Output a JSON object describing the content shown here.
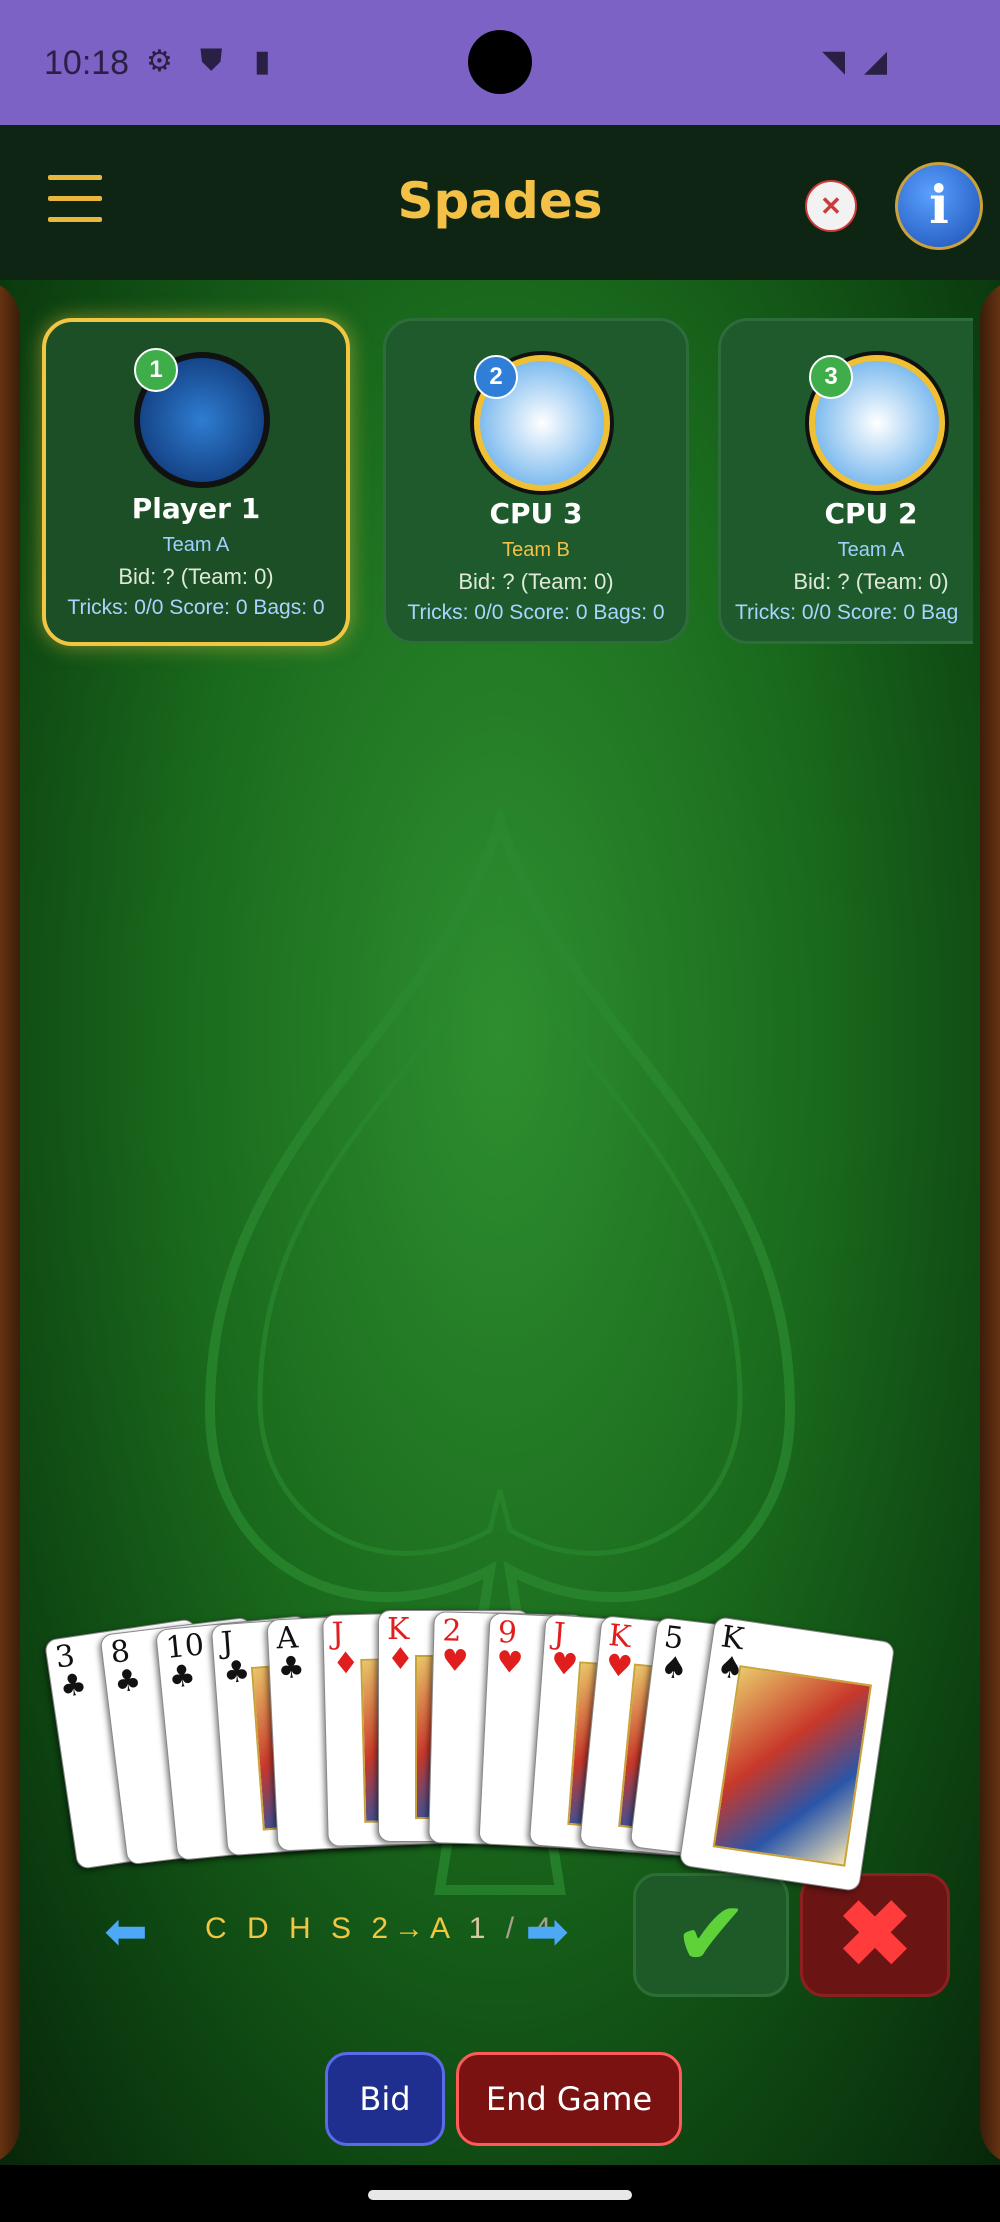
{
  "status_bar": {
    "time": "10:18"
  },
  "app_bar": {
    "title": "Spades"
  },
  "players": [
    {
      "number": "1",
      "name": "Player 1",
      "team": "Team A",
      "bid": "Bid: ?  (Team: 0)",
      "stats": "Tricks: 0/0  Score: 0  Bags: 0",
      "team_color": "#9fd0ff",
      "badge_color": "#3fae4a"
    },
    {
      "number": "2",
      "name": "CPU 3",
      "team": "Team B",
      "bid": "Bid: ?  (Team: 0)",
      "stats": "Tricks: 0/0  Score: 0  Bags: 0",
      "team_color": "#f3c146",
      "badge_color": "#2f7fd8"
    },
    {
      "number": "3",
      "name": "CPU 2",
      "team": "Team A",
      "bid": "Bid: ?  (Team: 0)",
      "stats": "Tricks: 0/0  Score: 0  Bag",
      "team_color": "#9fd0ff",
      "badge_color": "#3fae4a"
    }
  ],
  "hand": [
    {
      "rank": "3",
      "suit": "♣",
      "color": "black"
    },
    {
      "rank": "8",
      "suit": "♣",
      "color": "black"
    },
    {
      "rank": "10",
      "suit": "♣",
      "color": "black"
    },
    {
      "rank": "J",
      "suit": "♣",
      "color": "black"
    },
    {
      "rank": "A",
      "suit": "♣",
      "color": "black"
    },
    {
      "rank": "J",
      "suit": "♦",
      "color": "red"
    },
    {
      "rank": "K",
      "suit": "♦",
      "color": "red"
    },
    {
      "rank": "2",
      "suit": "♥",
      "color": "red"
    },
    {
      "rank": "9",
      "suit": "♥",
      "color": "red"
    },
    {
      "rank": "J",
      "suit": "♥",
      "color": "red"
    },
    {
      "rank": "K",
      "suit": "♥",
      "color": "red"
    },
    {
      "rank": "5",
      "suit": "♠",
      "color": "black"
    },
    {
      "rank": "K",
      "suit": "♠",
      "color": "black"
    }
  ],
  "sort_bar": {
    "label": "C D H S 2→A",
    "page": "1",
    "total": "/ 4"
  },
  "actions": {
    "bid_label": "Bid",
    "end_label": "End Game"
  },
  "icons": {
    "confirm": "check-icon",
    "cancel": "x-icon",
    "prev": "arrow-left-icon",
    "next": "arrow-right-icon"
  }
}
